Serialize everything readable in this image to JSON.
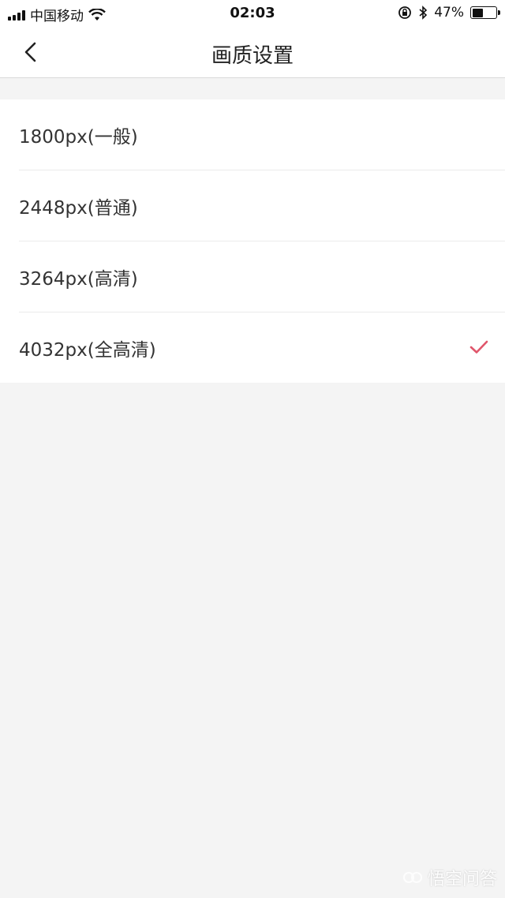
{
  "status_bar": {
    "carrier": "中国移动",
    "time": "02:03",
    "battery_percent": "47%",
    "battery_level": 0.47,
    "icons": [
      "signal-icon",
      "wifi-icon",
      "orientation-lock-icon",
      "bluetooth-icon",
      "battery-icon"
    ]
  },
  "nav": {
    "title": "画质设置",
    "back_icon": "chevron-left-icon"
  },
  "options": [
    {
      "label": "1800px(一般)",
      "selected": false
    },
    {
      "label": "2448px(普通)",
      "selected": false
    },
    {
      "label": "3264px(高清)",
      "selected": false
    },
    {
      "label": "4032px(全高清)",
      "selected": true
    }
  ],
  "colors": {
    "accent_check": "#e0566b",
    "page_background": "#f4f4f4"
  },
  "watermark": {
    "text": "悟空问答"
  }
}
